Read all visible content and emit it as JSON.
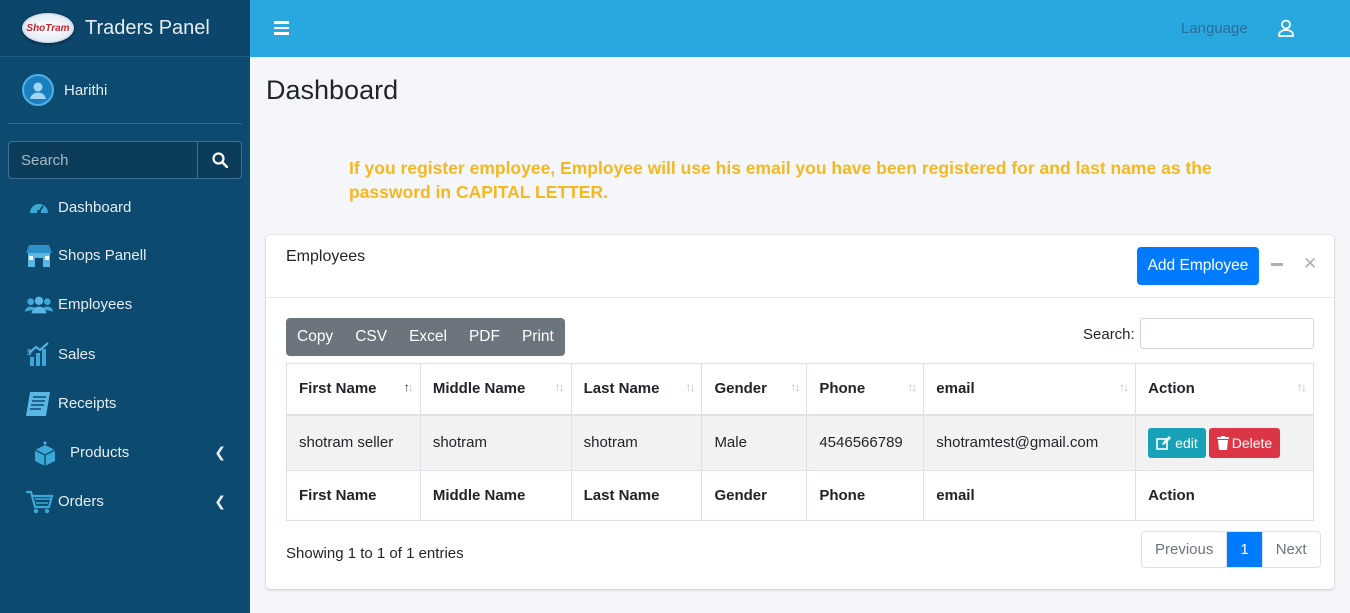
{
  "brand": {
    "logo_text": "ShoTram",
    "title": "Traders Panel"
  },
  "user": {
    "name": "Harithi"
  },
  "sidebar_search": {
    "placeholder": "Search"
  },
  "nav": [
    {
      "label": "Dashboard",
      "icon": "tachometer-icon"
    },
    {
      "label": "Shops Panell",
      "icon": "store-icon"
    },
    {
      "label": "Employees",
      "icon": "users-icon"
    },
    {
      "label": "Sales",
      "icon": "chart-icon"
    },
    {
      "label": "Receipts",
      "icon": "receipt-icon"
    },
    {
      "label": "Products",
      "icon": "box-icon",
      "has_submenu": true
    },
    {
      "label": "Orders",
      "icon": "cart-icon",
      "has_submenu": true
    }
  ],
  "topbar": {
    "language": "Language"
  },
  "page": {
    "title": "Dashboard",
    "notice": "If you register employee, Employee will use his email you have been registered for and last name as the password in CAPITAL LETTER."
  },
  "card": {
    "title": "Employees",
    "add_button": "Add Employee",
    "export_buttons": [
      "Copy",
      "CSV",
      "Excel",
      "PDF",
      "Print"
    ],
    "search_label": "Search:",
    "columns": [
      "First Name",
      "Middle Name",
      "Last Name",
      "Gender",
      "Phone",
      "email",
      "Action"
    ],
    "rows": [
      {
        "first_name": "shotram seller",
        "middle_name": "shotram",
        "last_name": "shotram",
        "gender": "Male",
        "phone": "4546566789",
        "email": "shotramtest@gmail.com"
      }
    ],
    "row_actions": {
      "edit": "edit",
      "delete": "Delete"
    },
    "info": "Showing 1 to 1 of 1 entries",
    "pagination": {
      "previous": "Previous",
      "current": "1",
      "next": "Next"
    }
  },
  "colors": {
    "sidebar": "#0d4a6f",
    "topbar": "#29a8df",
    "primary": "#007bff",
    "notice": "#f5b81f",
    "edit": "#17a2b8",
    "delete": "#dc3545"
  }
}
